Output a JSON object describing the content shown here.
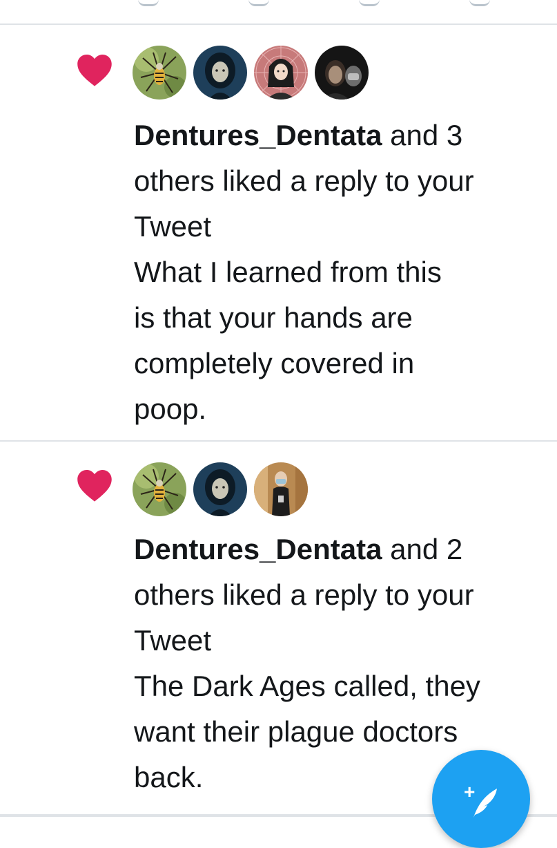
{
  "colors": {
    "like_heart": "#e0245e",
    "compose_button": "#1da1f2",
    "divider": "#dfe3e7",
    "text": "#14171a"
  },
  "notifications": [
    {
      "icon": "heart-icon",
      "avatar_count": 4,
      "user": "Dentures_Dentata",
      "headline": [
        " and 3",
        "others liked a reply to your",
        "Tweet"
      ],
      "reply": [
        "What I learned from this",
        "is that your hands are",
        "completely covered in",
        "poop."
      ]
    },
    {
      "icon": "heart-icon",
      "avatar_count": 3,
      "user": "Dentures_Dentata",
      "headline": [
        " and 2",
        "others liked a reply to your",
        "Tweet"
      ],
      "reply": [
        "The Dark Ages called, they",
        "want their plague doctors",
        "back."
      ]
    }
  ],
  "compose_button": {
    "icon": "compose-tweet-icon",
    "glyph": "+"
  }
}
